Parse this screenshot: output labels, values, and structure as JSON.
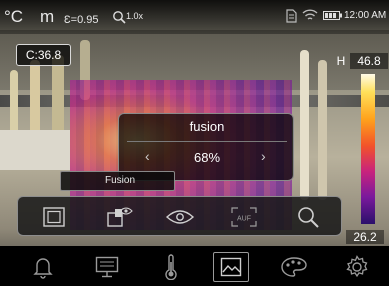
{
  "status_bar": {
    "unit_celsius": "°C",
    "unit_meter": "m",
    "emissivity": "Ɛ=0.95",
    "zoom_icon": "zoom-icon",
    "zoom_level": "1.0x",
    "storage_icon": "storage-icon",
    "wifi_icon": "wifi-icon",
    "battery_icon": "battery-icon",
    "time": "12:00 AM"
  },
  "center_temp": "C:36.8",
  "scale": {
    "high_label": "H",
    "high_value": "46.8",
    "low_value": "26.2",
    "colors": {
      "top": "#fffbe8",
      "mid": "#f2522a",
      "bottom": "#2b0f6b"
    }
  },
  "fusion_popup": {
    "title": "fusion",
    "value": "68%",
    "left_arrow": "‹",
    "right_arrow": "›"
  },
  "mode_label": "Fusion",
  "toolbar": {
    "buttons": [
      {
        "name": "full-frame-icon"
      },
      {
        "name": "picture-in-picture-icon"
      },
      {
        "name": "visible-eye-icon"
      },
      {
        "name": "auto-focus-icon",
        "text": "AUF"
      },
      {
        "name": "magnify-icon"
      }
    ]
  },
  "bottom_nav": {
    "items": [
      {
        "name": "alarm-bell-icon"
      },
      {
        "name": "monitor-icon"
      },
      {
        "name": "thermometer-icon"
      },
      {
        "name": "image-mode-icon",
        "active": true
      },
      {
        "name": "palette-icon"
      },
      {
        "name": "settings-gear-icon"
      }
    ]
  }
}
